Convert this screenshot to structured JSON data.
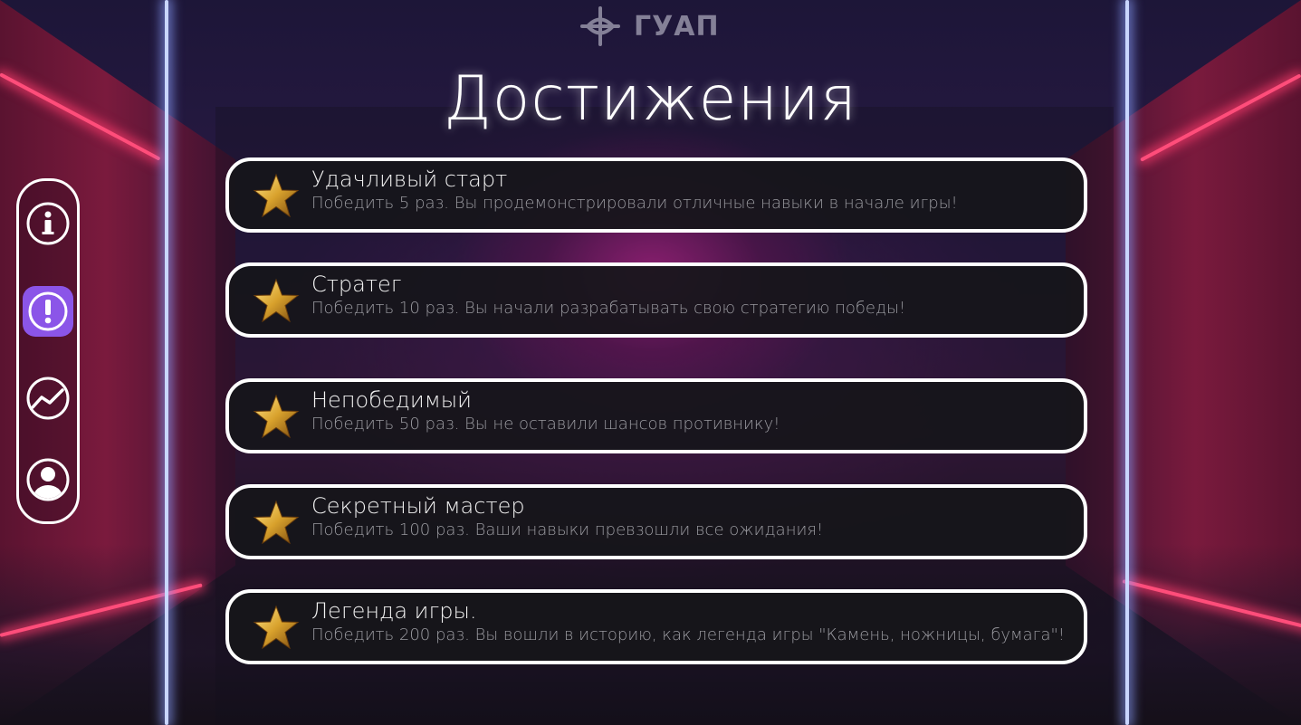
{
  "header": {
    "brand": "ГУАП",
    "title": "Достижения"
  },
  "sidebar": {
    "items": [
      {
        "icon": "info-icon",
        "active": false
      },
      {
        "icon": "exclamation-icon",
        "active": true
      },
      {
        "icon": "chart-icon",
        "active": false
      },
      {
        "icon": "user-icon",
        "active": false
      }
    ]
  },
  "achievements": [
    {
      "title": "Удачливый старт",
      "description": "Победить 5 раз. Вы продемонстрировали отличные навыки в начале игры!"
    },
    {
      "title": "Стратег",
      "description": "Победить 10 раз. Вы начали разрабатывать свою стратегию победы!"
    },
    {
      "title": "Непобедимый",
      "description": "Победить 50 раз. Вы не оставили шансов противнику!"
    },
    {
      "title": "Секретный мастер",
      "description": "Победить 100 раз. Ваши навыки превзошли все ожидания!"
    },
    {
      "title": "Легенда игры.",
      "description": "Победить 200 раз. Вы вошли в историю, как легенда игры \"Камень, ножницы, бумага\"!"
    }
  ],
  "colors": {
    "accent": "#8b55e8",
    "card_bg": "#16161a",
    "neon_pink": "#ff4d7a"
  }
}
